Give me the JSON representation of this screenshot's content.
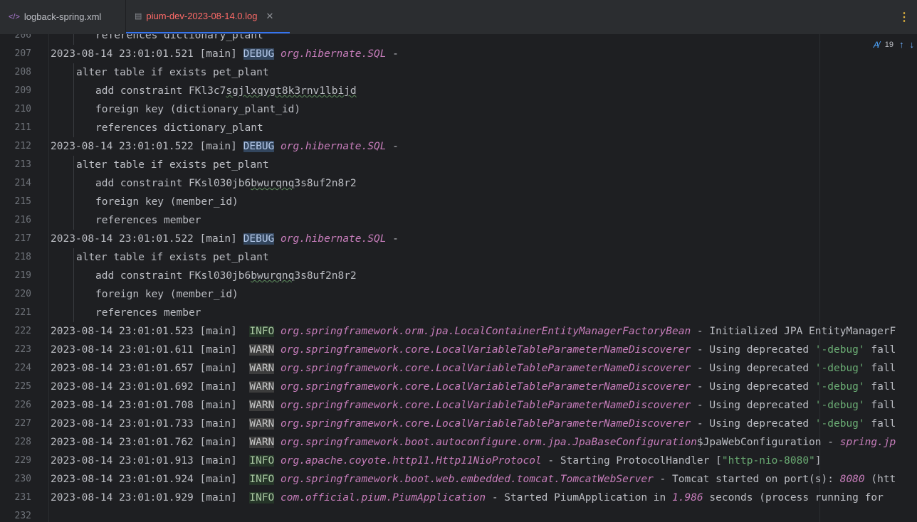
{
  "tabs": [
    {
      "label": "logback-spring.xml",
      "icon": "xml-tag-icon"
    },
    {
      "label": "pium-dev-2023-08-14.0.log",
      "icon": "log-file-icon",
      "active": true
    }
  ],
  "inspection": {
    "count": "19"
  },
  "lines": [
    {
      "n": "206",
      "indent": 2,
      "segs": [
        {
          "t": "references dictionary_plant"
        }
      ]
    },
    {
      "n": "207",
      "segs": [
        {
          "t": "2023-08-14 23:01:01.521 [main] "
        },
        {
          "t": "DEBUG",
          "c": "debug"
        },
        {
          "t": " "
        },
        {
          "t": "org.hibernate.SQL",
          "c": "logger"
        },
        {
          "t": " -"
        }
      ]
    },
    {
      "n": "208",
      "indent": 1,
      "segs": [
        {
          "t": "alter table if exists pet_plant"
        }
      ]
    },
    {
      "n": "209",
      "indent": 2,
      "segs": [
        {
          "t": "add constraint FKl3c7"
        },
        {
          "t": "sgjlxqygt8k3rnv1lbijd",
          "c": "squig"
        }
      ]
    },
    {
      "n": "210",
      "indent": 2,
      "segs": [
        {
          "t": "foreign key (dictionary_plant_id)"
        }
      ]
    },
    {
      "n": "211",
      "indent": 2,
      "segs": [
        {
          "t": "references dictionary_plant"
        }
      ]
    },
    {
      "n": "212",
      "segs": [
        {
          "t": "2023-08-14 23:01:01.522 [main] "
        },
        {
          "t": "DEBUG",
          "c": "debug"
        },
        {
          "t": " "
        },
        {
          "t": "org.hibernate.SQL",
          "c": "logger"
        },
        {
          "t": " -"
        }
      ]
    },
    {
      "n": "213",
      "indent": 1,
      "segs": [
        {
          "t": "alter table if exists pet_plant"
        }
      ]
    },
    {
      "n": "214",
      "indent": 2,
      "segs": [
        {
          "t": "add constraint FKsl030jb6"
        },
        {
          "t": "bwurqnq",
          "c": "squig"
        },
        {
          "t": "3s8uf2n8r2"
        }
      ]
    },
    {
      "n": "215",
      "indent": 2,
      "segs": [
        {
          "t": "foreign key (member_id)"
        }
      ]
    },
    {
      "n": "216",
      "indent": 2,
      "segs": [
        {
          "t": "references member"
        }
      ]
    },
    {
      "n": "217",
      "segs": [
        {
          "t": "2023-08-14 23:01:01.522 [main] "
        },
        {
          "t": "DEBUG",
          "c": "debug"
        },
        {
          "t": " "
        },
        {
          "t": "org.hibernate.SQL",
          "c": "logger"
        },
        {
          "t": " -"
        }
      ]
    },
    {
      "n": "218",
      "indent": 1,
      "segs": [
        {
          "t": "alter table if exists pet_plant"
        }
      ]
    },
    {
      "n": "219",
      "indent": 2,
      "segs": [
        {
          "t": "add constraint FKsl030jb6"
        },
        {
          "t": "bwurqnq",
          "c": "squig"
        },
        {
          "t": "3s8uf2n8r2"
        }
      ]
    },
    {
      "n": "220",
      "indent": 2,
      "segs": [
        {
          "t": "foreign key (member_id)"
        }
      ]
    },
    {
      "n": "221",
      "indent": 2,
      "segs": [
        {
          "t": "references member"
        }
      ]
    },
    {
      "n": "222",
      "segs": [
        {
          "t": "2023-08-14 23:01:01.523 [main]  "
        },
        {
          "t": "INFO",
          "c": "info"
        },
        {
          "t": " "
        },
        {
          "t": "org.springframework.orm.jpa.LocalContainerEntityManagerFactoryBean",
          "c": "logger"
        },
        {
          "t": " - Initialized JPA EntityManagerF"
        }
      ]
    },
    {
      "n": "223",
      "segs": [
        {
          "t": "2023-08-14 23:01:01.611 [main]  "
        },
        {
          "t": "WARN",
          "c": "warn"
        },
        {
          "t": " "
        },
        {
          "t": "org.springframework.core.LocalVariableTableParameterNameDiscoverer",
          "c": "logger"
        },
        {
          "t": " - Using deprecated "
        },
        {
          "t": "'-debug'",
          "c": "str"
        },
        {
          "t": " fall"
        }
      ]
    },
    {
      "n": "224",
      "segs": [
        {
          "t": "2023-08-14 23:01:01.657 [main]  "
        },
        {
          "t": "WARN",
          "c": "warn"
        },
        {
          "t": " "
        },
        {
          "t": "org.springframework.core.LocalVariableTableParameterNameDiscoverer",
          "c": "logger"
        },
        {
          "t": " - Using deprecated "
        },
        {
          "t": "'-debug'",
          "c": "str"
        },
        {
          "t": " fall"
        }
      ]
    },
    {
      "n": "225",
      "segs": [
        {
          "t": "2023-08-14 23:01:01.692 [main]  "
        },
        {
          "t": "WARN",
          "c": "warn"
        },
        {
          "t": " "
        },
        {
          "t": "org.springframework.core.LocalVariableTableParameterNameDiscoverer",
          "c": "logger"
        },
        {
          "t": " - Using deprecated "
        },
        {
          "t": "'-debug'",
          "c": "str"
        },
        {
          "t": " fall"
        }
      ]
    },
    {
      "n": "226",
      "segs": [
        {
          "t": "2023-08-14 23:01:01.708 [main]  "
        },
        {
          "t": "WARN",
          "c": "warn"
        },
        {
          "t": " "
        },
        {
          "t": "org.springframework.core.LocalVariableTableParameterNameDiscoverer",
          "c": "logger"
        },
        {
          "t": " - Using deprecated "
        },
        {
          "t": "'-debug'",
          "c": "str"
        },
        {
          "t": " fall"
        }
      ]
    },
    {
      "n": "227",
      "segs": [
        {
          "t": "2023-08-14 23:01:01.733 [main]  "
        },
        {
          "t": "WARN",
          "c": "warn"
        },
        {
          "t": " "
        },
        {
          "t": "org.springframework.core.LocalVariableTableParameterNameDiscoverer",
          "c": "logger"
        },
        {
          "t": " - Using deprecated "
        },
        {
          "t": "'-debug'",
          "c": "str"
        },
        {
          "t": " fall"
        }
      ]
    },
    {
      "n": "228",
      "segs": [
        {
          "t": "2023-08-14 23:01:01.762 [main]  "
        },
        {
          "t": "WARN",
          "c": "warn"
        },
        {
          "t": " "
        },
        {
          "t": "org.springframework.boot.autoconfigure.orm.jpa.JpaBaseConfiguration",
          "c": "logger"
        },
        {
          "t": "$JpaWebConfiguration - "
        },
        {
          "t": "spring.jp",
          "c": "logger"
        }
      ]
    },
    {
      "n": "229",
      "segs": [
        {
          "t": "2023-08-14 23:01:01.913 [main]  "
        },
        {
          "t": "INFO",
          "c": "info"
        },
        {
          "t": " "
        },
        {
          "t": "org.apache.coyote.http11.Http11NioProtocol",
          "c": "logger"
        },
        {
          "t": " - Starting ProtocolHandler ["
        },
        {
          "t": "\"http-nio-8080\"",
          "c": "str"
        },
        {
          "t": "]"
        }
      ]
    },
    {
      "n": "230",
      "segs": [
        {
          "t": "2023-08-14 23:01:01.924 [main]  "
        },
        {
          "t": "INFO",
          "c": "info"
        },
        {
          "t": " "
        },
        {
          "t": "org.springframework.boot.web.embedded.tomcat.TomcatWebServer",
          "c": "logger"
        },
        {
          "t": " - Tomcat started on port(s): "
        },
        {
          "t": "8080",
          "c": "num"
        },
        {
          "t": " (htt"
        }
      ]
    },
    {
      "n": "231",
      "segs": [
        {
          "t": "2023-08-14 23:01:01.929 [main]  "
        },
        {
          "t": "INFO",
          "c": "info"
        },
        {
          "t": " "
        },
        {
          "t": "com.official.pium.PiumApplication",
          "c": "logger"
        },
        {
          "t": " - Started PiumApplication in "
        },
        {
          "t": "1.986",
          "c": "num"
        },
        {
          "t": " seconds (process running for "
        }
      ]
    },
    {
      "n": "232",
      "segs": []
    }
  ]
}
